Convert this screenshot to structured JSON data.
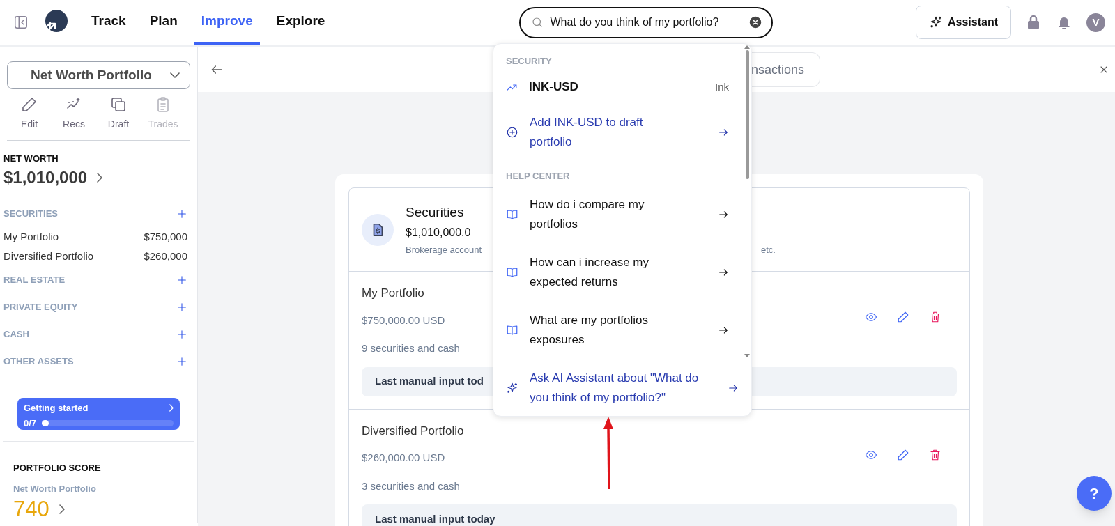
{
  "nav": {
    "tabs": [
      {
        "label": "Track",
        "selected": false
      },
      {
        "label": "Plan",
        "selected": false
      },
      {
        "label": "Improve",
        "selected": true
      },
      {
        "label": "Explore",
        "selected": false
      }
    ]
  },
  "search": {
    "value": "What do you think of my portfolio?"
  },
  "header_actions": {
    "assistant_label": "Assistant",
    "avatar_initial": "V"
  },
  "sidebar": {
    "portfolio_selector": "Net Worth Portfolio",
    "tools": [
      {
        "kind": "edit",
        "label": "Edit",
        "disabled": false
      },
      {
        "kind": "recs",
        "label": "Recs",
        "disabled": false
      },
      {
        "kind": "draft",
        "label": "Draft",
        "disabled": false
      },
      {
        "kind": "trades",
        "label": "Trades",
        "disabled": true
      }
    ],
    "net_worth": {
      "label": "NET WORTH",
      "value": "$1,010,000"
    },
    "sections": [
      {
        "title": "SECURITIES",
        "items": [
          {
            "name": "My Portfolio",
            "value": "$750,000"
          },
          {
            "name": "Diversified Portfolio",
            "value": "$260,000"
          }
        ]
      },
      {
        "title": "REAL ESTATE"
      },
      {
        "title": "PRIVATE EQUITY"
      },
      {
        "title": "CASH"
      },
      {
        "title": "OTHER ASSETS"
      }
    ],
    "getting_started": {
      "title": "Getting started",
      "progress": "0/7",
      "level": 0
    },
    "portfolio_score": {
      "label": "PORTFOLIO SCORE",
      "portfolio": "Net Worth Portfolio",
      "score": "740"
    }
  },
  "toolbar": {
    "transactions_button": "nsactions"
  },
  "securities_card": {
    "title": "Securities",
    "total": "$1,010,000.0",
    "description_start": "Brokerage account",
    "description_end": "etc.",
    "portfolios": [
      {
        "name": "My Portfolio",
        "value": "$750,000.00 USD",
        "holdings": "9 securities and cash",
        "last_input": "Last manual input tod"
      },
      {
        "name": "Diversified Portfolio",
        "value": "$260,000.00 USD",
        "holdings": "3 securities and cash",
        "last_input": "Last manual input today"
      }
    ]
  },
  "dropdown": {
    "groups": [
      {
        "title": "SECURITY",
        "items": [
          {
            "kind": "security",
            "label": "INK-USD",
            "detail": "Ink"
          },
          {
            "kind": "action",
            "label": "Add INK-USD to draft portfolio"
          }
        ]
      },
      {
        "title": "HELP CENTER",
        "items": [
          {
            "kind": "article",
            "label": "How do i compare my portfolios"
          },
          {
            "kind": "article",
            "label": "How can i increase my expected returns"
          },
          {
            "kind": "article",
            "label": "What are my portfolios exposures"
          }
        ]
      }
    ],
    "footer": "Ask AI Assistant about \"What do you think of my portfolio?\""
  },
  "help_button": {
    "label": "?"
  }
}
